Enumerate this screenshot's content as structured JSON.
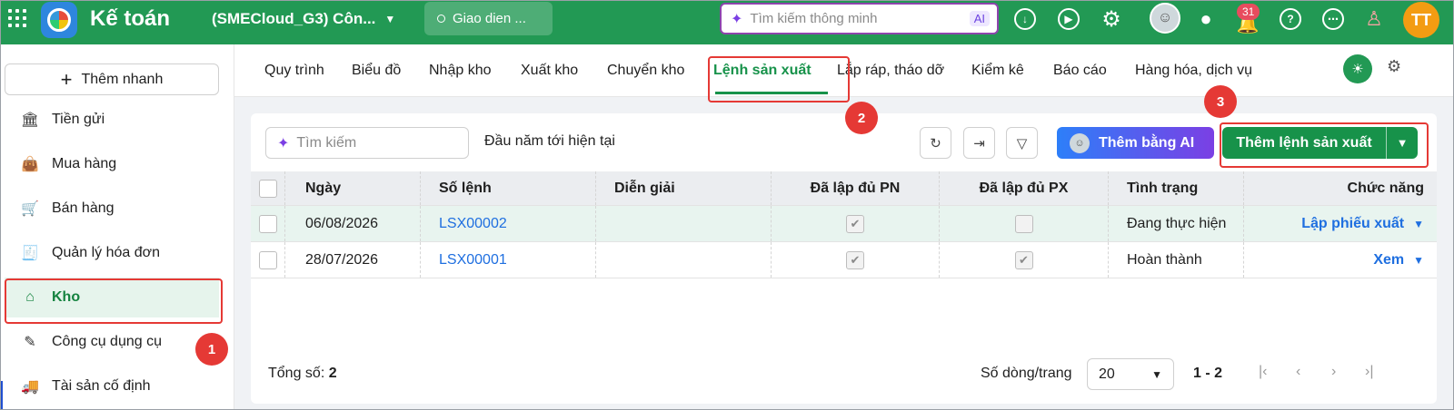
{
  "topbar": {
    "app_title": "Kế toán",
    "company": "(SMECloud_G3) Côn...",
    "ui_button": "Giao dien ...",
    "smart_search_placeholder": "Tìm kiếm thông minh",
    "smart_search_ai": "AI",
    "notification_count": "31",
    "user_initials": "TT"
  },
  "sidebar": {
    "quick_add": "Thêm nhanh",
    "items": [
      {
        "label": "Tiền gửi",
        "icon": "bank-icon"
      },
      {
        "label": "Mua hàng",
        "icon": "shopping-bag-icon"
      },
      {
        "label": "Bán hàng",
        "icon": "cart-icon"
      },
      {
        "label": "Quản lý hóa đơn",
        "icon": "invoice-icon"
      },
      {
        "label": "Kho",
        "icon": "warehouse-icon",
        "active": true
      },
      {
        "label": "Công cụ dụng cụ",
        "icon": "tools-icon"
      },
      {
        "label": "Tài sản cố định",
        "icon": "vehicle-icon"
      }
    ]
  },
  "tabs": [
    "Quy trình",
    "Biểu đồ",
    "Nhập kho",
    "Xuất kho",
    "Chuyển kho",
    "Lệnh sản xuất",
    "Lắp ráp, tháo dỡ",
    "Kiểm kê",
    "Báo cáo",
    "Hàng hóa, dịch vụ"
  ],
  "active_tab": "Lệnh sản xuất",
  "toolbar": {
    "search_placeholder": "Tìm kiếm",
    "period": "Đầu năm tới hiện tại",
    "ai_button": "Thêm bằng AI",
    "add_button": "Thêm lệnh sản xuất"
  },
  "table": {
    "headers": [
      "Ngày",
      "Số lệnh",
      "Diễn giải",
      "Đã lập đủ PN",
      "Đã lập đủ PX",
      "Tình trạng",
      "Chức năng"
    ],
    "rows": [
      {
        "date": "06/08/2026",
        "number": "LSX00002",
        "desc": "",
        "pn": true,
        "px": false,
        "status": "Đang thực hiện",
        "action": "Lập phiếu xuất"
      },
      {
        "date": "28/07/2026",
        "number": "LSX00001",
        "desc": "",
        "pn": true,
        "px": true,
        "status": "Hoàn thành",
        "action": "Xem"
      }
    ]
  },
  "footer": {
    "total_label": "Tổng số:",
    "total_value": "2",
    "rows_per_page_label": "Số dòng/trang",
    "rows_per_page": "20",
    "range": "1 - 2"
  },
  "annotations": {
    "step1": "1",
    "step2": "2",
    "step3": "3",
    "highlight_color": "#e53935"
  },
  "colors": {
    "brand_green": "#229954",
    "active_green": "#17924a",
    "link_blue": "#1f6fe0"
  }
}
